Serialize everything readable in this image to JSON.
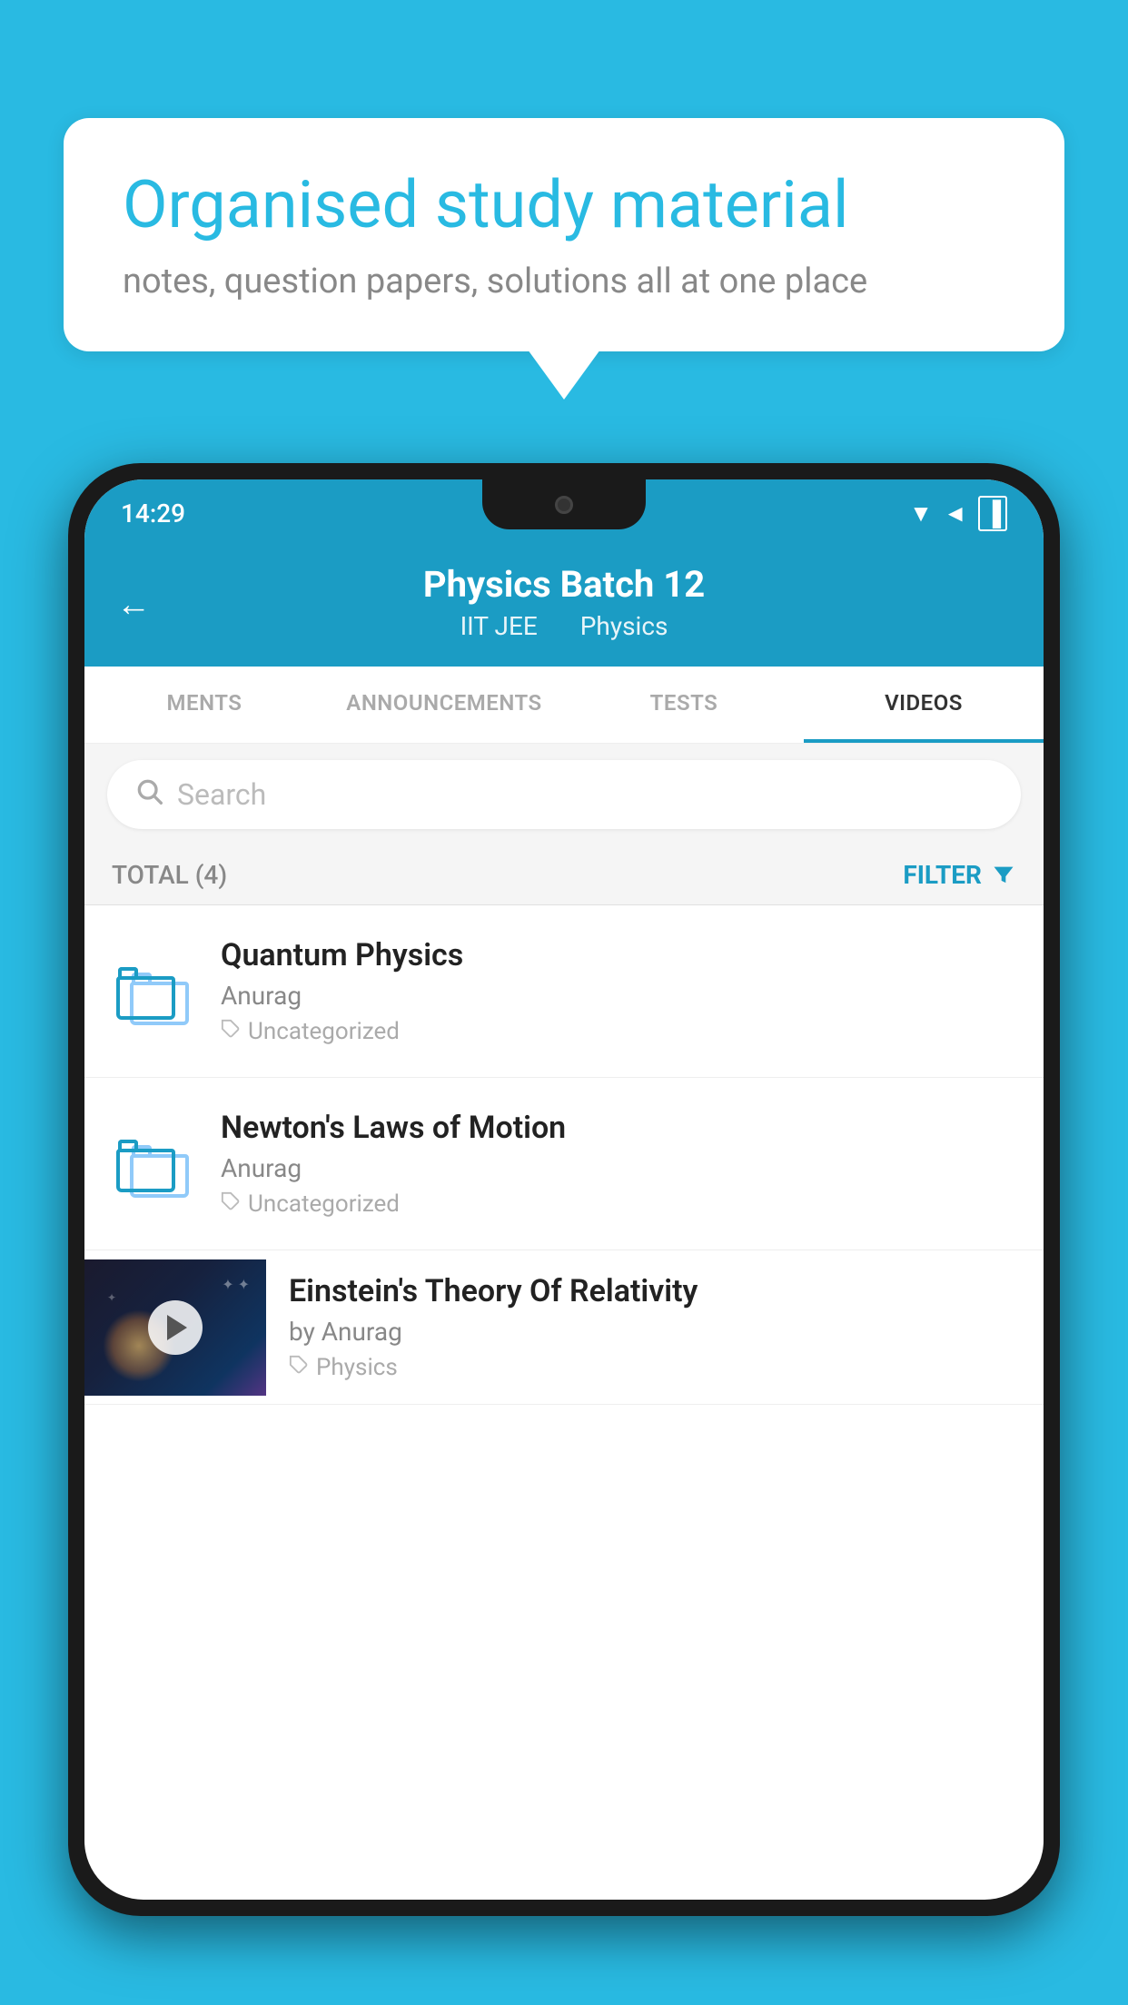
{
  "background_color": "#29BAE2",
  "speech_bubble": {
    "title": "Organised study material",
    "subtitle": "notes, question papers, solutions all at one place"
  },
  "phone": {
    "status_bar": {
      "time": "14:29",
      "icons": [
        "wifi",
        "signal",
        "battery"
      ]
    },
    "top_bar": {
      "back_label": "←",
      "title": "Physics Batch 12",
      "subtitle_1": "IIT JEE",
      "subtitle_2": "Physics"
    },
    "tabs": [
      {
        "label": "MENTS",
        "active": false
      },
      {
        "label": "ANNOUNCEMENTS",
        "active": false
      },
      {
        "label": "TESTS",
        "active": false
      },
      {
        "label": "VIDEOS",
        "active": true
      }
    ],
    "search": {
      "placeholder": "Search"
    },
    "filter_row": {
      "total_label": "TOTAL (4)",
      "filter_label": "FILTER"
    },
    "list_items": [
      {
        "type": "folder",
        "title": "Quantum Physics",
        "author": "Anurag",
        "tag": "Uncategorized"
      },
      {
        "type": "folder",
        "title": "Newton's Laws of Motion",
        "author": "Anurag",
        "tag": "Uncategorized"
      },
      {
        "type": "video",
        "title": "Einstein's Theory Of Relativity",
        "author": "by Anurag",
        "tag": "Physics"
      }
    ]
  }
}
